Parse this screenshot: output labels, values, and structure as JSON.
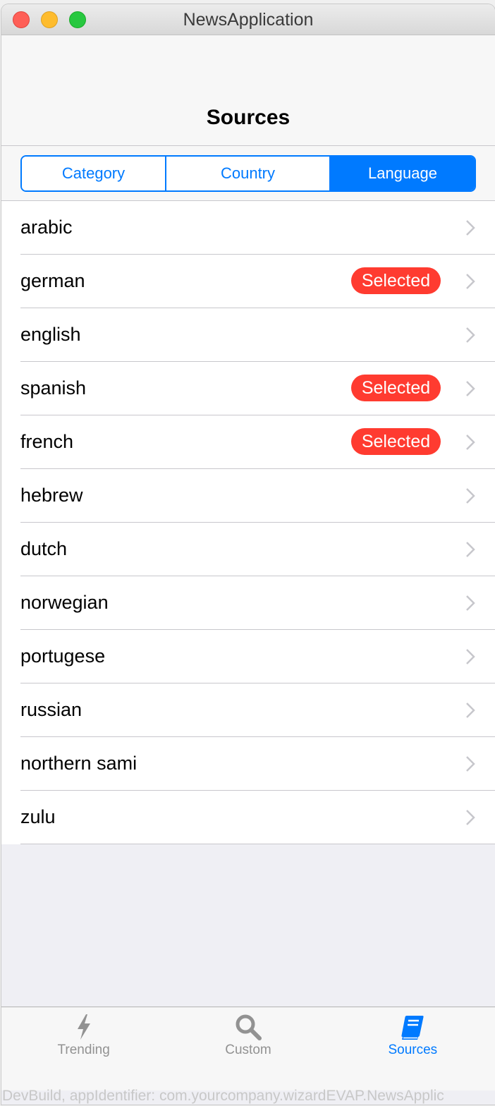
{
  "window": {
    "title": "NewsApplication"
  },
  "navbar": {
    "title": "Sources"
  },
  "segmented": {
    "items": [
      {
        "label": "Category",
        "active": false
      },
      {
        "label": "Country",
        "active": false
      },
      {
        "label": "Language",
        "active": true
      }
    ]
  },
  "list": {
    "rows": [
      {
        "label": "arabic",
        "badge": ""
      },
      {
        "label": "german",
        "badge": "Selected"
      },
      {
        "label": "english",
        "badge": ""
      },
      {
        "label": "spanish",
        "badge": "Selected"
      },
      {
        "label": "french",
        "badge": "Selected"
      },
      {
        "label": "hebrew",
        "badge": ""
      },
      {
        "label": "dutch",
        "badge": ""
      },
      {
        "label": "norwegian",
        "badge": ""
      },
      {
        "label": "portugese",
        "badge": ""
      },
      {
        "label": "russian",
        "badge": ""
      },
      {
        "label": "northern sami",
        "badge": ""
      },
      {
        "label": "zulu",
        "badge": ""
      }
    ]
  },
  "tabbar": {
    "items": [
      {
        "label": "Trending",
        "icon": "bolt-icon",
        "active": false
      },
      {
        "label": "Custom",
        "icon": "search-icon",
        "active": false
      },
      {
        "label": "Sources",
        "icon": "book-icon",
        "active": true
      }
    ]
  },
  "footer": {
    "text": "DevBuild, appIdentifier: com.yourcompany.wizardEVAP.NewsApplic"
  },
  "colors": {
    "accent": "#007aff",
    "badge": "#ff3b30",
    "inactive": "#929292"
  }
}
